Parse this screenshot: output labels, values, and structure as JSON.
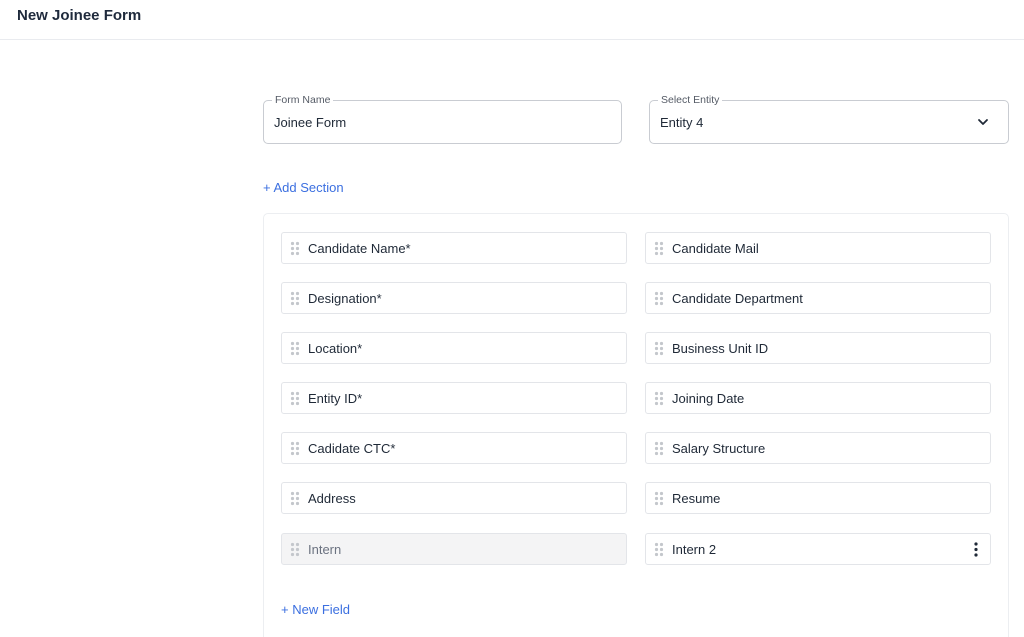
{
  "header": {
    "title": "New Joinee Form"
  },
  "form": {
    "form_name_label": "Form Name",
    "form_name_value": "Joinee Form",
    "entity_label": "Select Entity",
    "entity_value": "Entity 4"
  },
  "actions": {
    "add_section": "+ Add Section",
    "new_field": "+ New Field"
  },
  "fields": {
    "left": [
      "Candidate Name*",
      "Designation*",
      "Location*",
      "Entity ID*",
      "Cadidate CTC*",
      "Address",
      "Intern"
    ],
    "right": [
      "Candidate Mail",
      "Candidate Department",
      "Business Unit ID",
      "Joining Date",
      "Salary Structure",
      "Resume",
      "Intern 2"
    ]
  },
  "icons": {
    "drag": "drag-handle-icon",
    "chevron": "chevron-down-icon",
    "more": "more-vertical-icon"
  },
  "colors": {
    "accent": "#3b6fe0",
    "disabled_bg": "#f4f4f5"
  }
}
